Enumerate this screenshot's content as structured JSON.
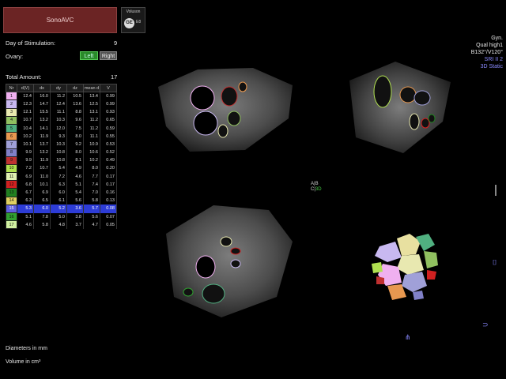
{
  "header": {
    "title": "SonoAVC",
    "logo_brand": "Voluson",
    "logo_mark": "GE",
    "logo_suffix": "E8"
  },
  "stimulation": {
    "label": "Day of Stimulation:",
    "value": "9"
  },
  "ovary": {
    "label": "Ovary:",
    "left": "Left",
    "right": "Right"
  },
  "total": {
    "label": "Total Amount:",
    "value": "17"
  },
  "table": {
    "headers": [
      "Nr",
      "d(V)",
      "dx",
      "dy",
      "dz",
      "mean d",
      "V"
    ],
    "rows": [
      {
        "nr": "1",
        "color": "#f0b0f0",
        "vals": [
          "12.4",
          "16.0",
          "11.2",
          "10.5",
          "13.4",
          "0.99"
        ]
      },
      {
        "nr": "2",
        "color": "#c8b8f0",
        "vals": [
          "12.3",
          "14.7",
          "12.4",
          "13.6",
          "12.5",
          "0.99"
        ]
      },
      {
        "nr": "3",
        "color": "#e8e8b0",
        "vals": [
          "12.1",
          "15.5",
          "11.1",
          "8.8",
          "13.1",
          "0.93"
        ]
      },
      {
        "nr": "4",
        "color": "#90c060",
        "vals": [
          "10.7",
          "13.2",
          "10.3",
          "9.6",
          "11.2",
          "0.65"
        ]
      },
      {
        "nr": "5",
        "color": "#50b080",
        "vals": [
          "10.4",
          "14.1",
          "12.0",
          "7.5",
          "11.2",
          "0.59"
        ]
      },
      {
        "nr": "6",
        "color": "#e89850",
        "vals": [
          "10.2",
          "11.9",
          "9.3",
          "8.0",
          "11.1",
          "0.55"
        ]
      },
      {
        "nr": "7",
        "color": "#a0a0d8",
        "vals": [
          "10.1",
          "13.7",
          "10.3",
          "9.2",
          "10.9",
          "0.53"
        ]
      },
      {
        "nr": "8",
        "color": "#8080c8",
        "vals": [
          "9.9",
          "13.2",
          "10.8",
          "8.0",
          "10.6",
          "0.52"
        ]
      },
      {
        "nr": "9",
        "color": "#c03030",
        "vals": [
          "9.9",
          "11.9",
          "10.8",
          "8.1",
          "10.2",
          "0.49"
        ]
      },
      {
        "nr": "10",
        "color": "#b0e050",
        "vals": [
          "7.2",
          "10.7",
          "5.4",
          "4.9",
          "8.0",
          "0.20"
        ]
      },
      {
        "nr": "11",
        "color": "#e0f0b0",
        "vals": [
          "6.9",
          "11.0",
          "7.2",
          "4.6",
          "7.7",
          "0.17"
        ]
      },
      {
        "nr": "12",
        "color": "#d02020",
        "vals": [
          "6.8",
          "10.1",
          "6.3",
          "5.1",
          "7.4",
          "0.17"
        ]
      },
      {
        "nr": "13",
        "color": "#208020",
        "vals": [
          "6.7",
          "6.9",
          "6.0",
          "5.4",
          "7.0",
          "0.16"
        ]
      },
      {
        "nr": "14",
        "color": "#e0d060",
        "vals": [
          "6.3",
          "6.5",
          "6.1",
          "5.6",
          "5.8",
          "0.13"
        ]
      },
      {
        "nr": "15",
        "color": "#6060e0",
        "vals": [
          "5.3",
          "6.0",
          "5.2",
          "3.6",
          "5.7",
          "0.08"
        ],
        "selected": true
      },
      {
        "nr": "16",
        "color": "#30a030",
        "vals": [
          "5.1",
          "7.8",
          "5.0",
          "3.8",
          "5.6",
          "0.07"
        ]
      },
      {
        "nr": "17",
        "color": "#d0f0a0",
        "vals": [
          "4.6",
          "5.8",
          "4.8",
          "3.7",
          "4.7",
          "0.05"
        ]
      }
    ]
  },
  "footer": {
    "diameters": "Diameters in mm",
    "volume": "Volume in cm³"
  },
  "render_info": {
    "line1": "Gyn.",
    "line2": "Qual high1",
    "line3": "B132°/V120°",
    "line4": "SRI II 2",
    "line5": "3D Static"
  },
  "view_marker": {
    "a": "A",
    "b": "B",
    "c": "C",
    "d": "3D"
  },
  "colors": {
    "title_bg": "#6b2424",
    "selected_row": "#2d3cd6",
    "left_button": "#2a8a2a",
    "render_info_blue": "#8a8aff"
  }
}
